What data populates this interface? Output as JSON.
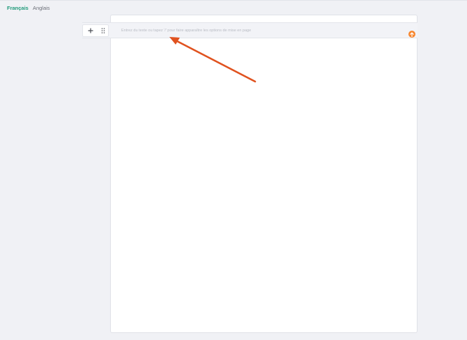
{
  "language_tabs": {
    "active": "Français",
    "inactive": "Anglais"
  },
  "editor": {
    "placeholder": "Entrez du texte ou tapez '/' pour faire apparaître les options de mise en page",
    "tools": {
      "add_icon": "plus-icon",
      "drag_icon": "drag-handle-icon"
    },
    "badge_icon": "arrow-up-circle-icon"
  },
  "colors": {
    "accent_green": "#1f9a79",
    "badge_orange": "#f7862d",
    "annotation_arrow": "#e0521f",
    "background": "#f0f1f5"
  }
}
